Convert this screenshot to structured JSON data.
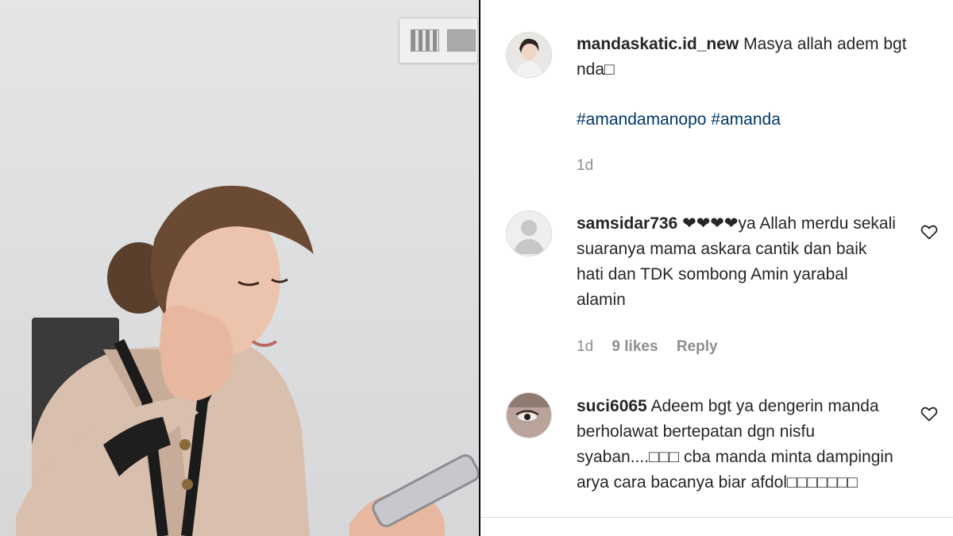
{
  "post": {
    "caption": {
      "username": "mandaskatic.id_new",
      "text": "Masya allah adem bgt nda□",
      "hashtags": [
        "#amandamanopo",
        "#amanda"
      ],
      "time": "1d"
    },
    "comments": [
      {
        "username": "samsidar736",
        "text": "❤❤❤❤ya Allah merdu sekali suaranya mama askara cantik dan baik hati dan TDK sombong Amin yarabal alamin",
        "time": "1d",
        "likes": "9 likes",
        "reply_label": "Reply",
        "avatar": "default-avatar"
      },
      {
        "username": "suci6065",
        "text": "Adeem bgt ya dengerin manda berholawat bertepatan dgn nisfu syaban....□□□ cba manda minta dampingin arya cara bacanya biar afdol□□□□□□□",
        "avatar": "photo-avatar"
      }
    ]
  },
  "icons": {
    "like": "heart-outline-icon"
  },
  "colors": {
    "text": "#262626",
    "secondary": "#8e8e8e",
    "hashtag": "#00376b",
    "divider": "#0b0b0b"
  }
}
